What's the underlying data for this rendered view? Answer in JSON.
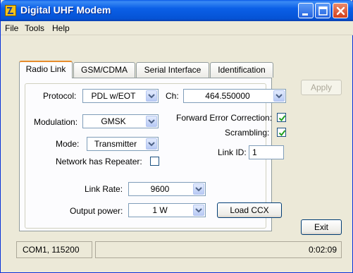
{
  "window": {
    "title": "Digital UHF Modem"
  },
  "menu": {
    "file": "File",
    "tools": "Tools",
    "help": "Help"
  },
  "tabs": [
    {
      "label": "Radio Link",
      "active": true
    },
    {
      "label": "GSM/CDMA",
      "active": false
    },
    {
      "label": "Serial Interface",
      "active": false
    },
    {
      "label": "Identification",
      "active": false
    }
  ],
  "form": {
    "protocol_label": "Protocol:",
    "protocol_value": "PDL w/EOT",
    "channel_label": "Ch:",
    "channel_value": "464.550000",
    "modulation_label": "Modulation:",
    "modulation_value": "GMSK",
    "fec_label": "Forward Error Correction:",
    "fec_checked": true,
    "scrambling_label": "Scrambling:",
    "scrambling_checked": true,
    "mode_label": "Mode:",
    "mode_value": "Transmitter",
    "link_id_label": "Link ID:",
    "link_id_value": "1",
    "repeater_label": "Network has Repeater:",
    "repeater_checked": false,
    "link_rate_label": "Link Rate:",
    "link_rate_value": "9600",
    "output_power_label": "Output power:",
    "output_power_value": "1 W",
    "load_ccx_label": "Load CCX"
  },
  "buttons": {
    "apply": "Apply",
    "exit": "Exit"
  },
  "status": {
    "port": "COM1, 115200",
    "elapsed": "0:02:09"
  },
  "colors": {
    "titlebar": "#0553d5",
    "window_bg": "#ece9d8",
    "tab_accent": "#e68b2c",
    "check_mark": "#21a121"
  },
  "icons": [
    "app-icon",
    "minimize-icon",
    "maximize-icon",
    "close-icon",
    "chevron-down-icon",
    "checkmark-icon"
  ]
}
